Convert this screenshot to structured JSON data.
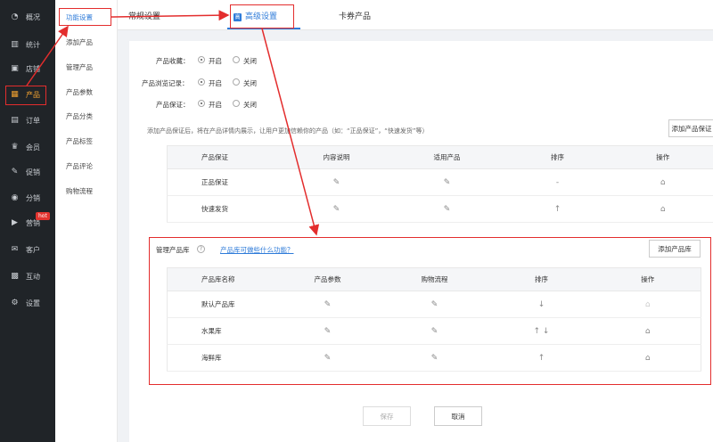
{
  "sidebar": {
    "items": [
      {
        "icon": "gauge-icon",
        "glyph": "◔",
        "label": "概况"
      },
      {
        "icon": "chart-icon",
        "glyph": "▥",
        "label": "统计"
      },
      {
        "icon": "shop-icon",
        "glyph": "▣",
        "label": "店铺"
      },
      {
        "icon": "product-icon",
        "glyph": "▦",
        "label": "产品"
      },
      {
        "icon": "order-icon",
        "glyph": "▤",
        "label": "订单"
      },
      {
        "icon": "member-icon",
        "glyph": "♛",
        "label": "会员"
      },
      {
        "icon": "promo-icon",
        "glyph": "✎",
        "label": "促销"
      },
      {
        "icon": "distribution-icon",
        "glyph": "◉",
        "label": "分销"
      },
      {
        "icon": "marketing-icon",
        "glyph": "▶",
        "label": "营销"
      },
      {
        "icon": "guest-icon",
        "glyph": "✉",
        "label": "客户"
      },
      {
        "icon": "interact-icon",
        "glyph": "▩",
        "label": "互动"
      },
      {
        "icon": "settings-icon",
        "glyph": "⚙",
        "label": "设置"
      }
    ],
    "hot_badge": "hot"
  },
  "submenu": {
    "items": [
      "功能设置",
      "添加产品",
      "管理产品",
      "产品参数",
      "产品分类",
      "产品标签",
      "产品评论",
      "购物流程"
    ]
  },
  "tabs": [
    "常规设置",
    "高级设置",
    "卡券产品"
  ],
  "form": {
    "rows": [
      {
        "label": "产品收藏：",
        "on": "开启",
        "off": "关闭"
      },
      {
        "label": "产品浏览记录：",
        "on": "开启",
        "off": "关闭"
      },
      {
        "label": "产品保证：",
        "on": "开启",
        "off": "关闭"
      }
    ],
    "guarantee_tip": "添加产品保证后，将在产品详情内展示，让用户更加信赖你的产品（如：“正品保证”，“快速发货”等）",
    "add_guarantee_button": "添加产品保证"
  },
  "guarantee_table": {
    "headers": [
      "产品保证",
      "内容说明",
      "适用产品",
      "排序",
      "操作"
    ],
    "rows": [
      {
        "name": "正品保证",
        "sort": "-"
      },
      {
        "name": "快速发货",
        "sort": "↑"
      }
    ]
  },
  "library": {
    "label": "管理产品库",
    "help": "?",
    "link": "产品库可做些什么功能？",
    "add_button": "添加产品库",
    "headers": [
      "产品库名称",
      "产品参数",
      "购物流程",
      "排序",
      "操作"
    ],
    "rows": [
      {
        "name": "默认产品库",
        "sort": "↓"
      },
      {
        "name": "水果库",
        "sort": "↑ ↓"
      },
      {
        "name": "海鲜库",
        "sort": "↑"
      }
    ]
  },
  "footer": {
    "save": "保存",
    "cancel": "取消"
  },
  "colors": {
    "accent": "#2e7bd9",
    "annotation": "#e32d2d",
    "sidebar_bg": "#202428"
  }
}
